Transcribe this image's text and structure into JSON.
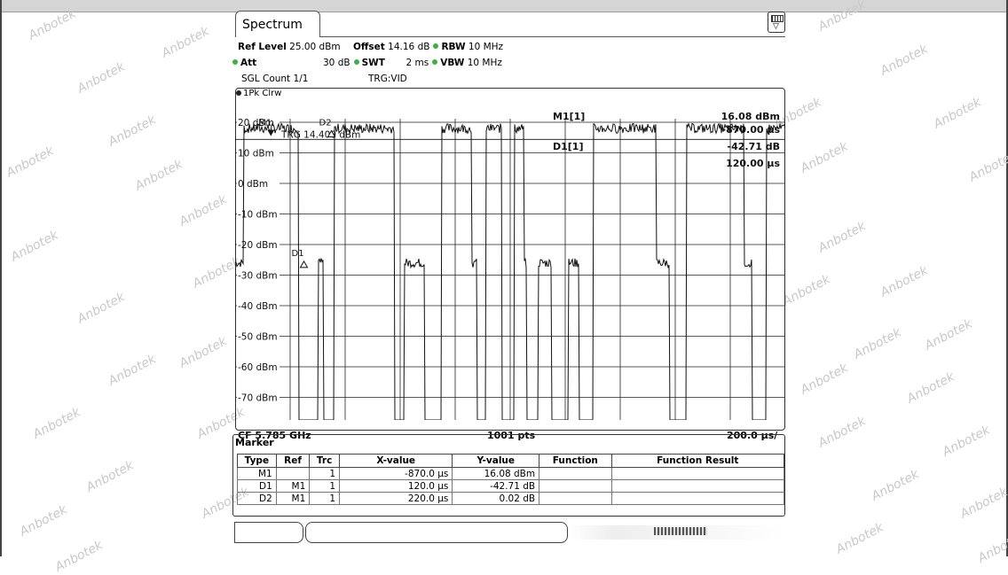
{
  "watermark": "Anbotek",
  "tab": {
    "label": "Spectrum"
  },
  "settings": {
    "ref_level_label": "Ref Level",
    "ref_level_value": "25.00 dBm",
    "offset_label": "Offset",
    "offset_value": "14.16 dB",
    "rbw_label": "RBW",
    "rbw_value": "10 MHz",
    "att_label": "Att",
    "att_value": "30 dB",
    "swt_label": "SWT",
    "swt_value": "2 ms",
    "vbw_label": "VBW",
    "vbw_value": "10 MHz",
    "sgl_count": "SGL Count 1/1",
    "trigger": "TRG:VID"
  },
  "trace": {
    "label": "1Pk Clrw"
  },
  "chart_data": {
    "type": "line",
    "title": "",
    "y_ticks": [
      "20 dBm",
      "10 dBm",
      "0 dBm",
      "-10 dBm",
      "-20 dBm",
      "-30 dBm",
      "-40 dBm",
      "-50 dBm",
      "-60 dBm",
      "-70 dBm"
    ],
    "ylim": [
      -80,
      25
    ],
    "x_range_us": [
      -1000,
      1000
    ],
    "grid": true,
    "trigger_level_dbm": 14.4,
    "trigger_label": "TRG  14.400 dBm",
    "pulse_high_dbm": 18,
    "pulse_low_dbm": -26,
    "pulses_high_us": [
      [
        -970,
        -710
      ],
      [
        -650,
        -400
      ],
      [
        -300,
        -140
      ],
      [
        -95,
        50
      ],
      [
        300,
        530
      ],
      [
        600,
        850
      ],
      [
        920,
        1000
      ]
    ],
    "dips_us": [
      [
        -770,
        -700
      ],
      [
        -680,
        -640
      ],
      [
        -420,
        -385
      ],
      [
        -310,
        -250
      ],
      [
        -120,
        -90
      ],
      [
        -30,
        15
      ],
      [
        60,
        100
      ],
      [
        150,
        210
      ],
      [
        250,
        300
      ],
      [
        580,
        640
      ],
      [
        880,
        930
      ]
    ],
    "markers": [
      {
        "name": "M1",
        "x_us": -870,
        "y_dbm": 16.08
      },
      {
        "name": "D2",
        "x_us": -650,
        "y_dbm": 16.1
      },
      {
        "name": "D1",
        "x_us": -750,
        "y_dbm": -26.63
      }
    ],
    "marker_readout": {
      "m1_label": "M1[1]",
      "m1_value": "16.08 dBm",
      "m1_x": "-870.00 µs",
      "d1_label": "D1[1]",
      "d1_value": "-42.71 dB",
      "d1_x": "120.00 µs"
    },
    "footer": {
      "cf": "CF 5.785 GHz",
      "pts": "1001 pts",
      "span": "200.0 µs/"
    }
  },
  "marker_table": {
    "title": "Marker",
    "headers": [
      "Type",
      "Ref",
      "Trc",
      "X-value",
      "Y-value",
      "Function",
      "Function Result"
    ],
    "rows": [
      [
        "M1",
        "",
        "1",
        "-870.0 µs",
        "16.08 dBm",
        "",
        ""
      ],
      [
        "D1",
        "M1",
        "1",
        "120.0 µs",
        "-42.71 dB",
        "",
        ""
      ],
      [
        "D2",
        "M1",
        "1",
        "220.0 µs",
        "0.02 dB",
        "",
        ""
      ]
    ]
  }
}
